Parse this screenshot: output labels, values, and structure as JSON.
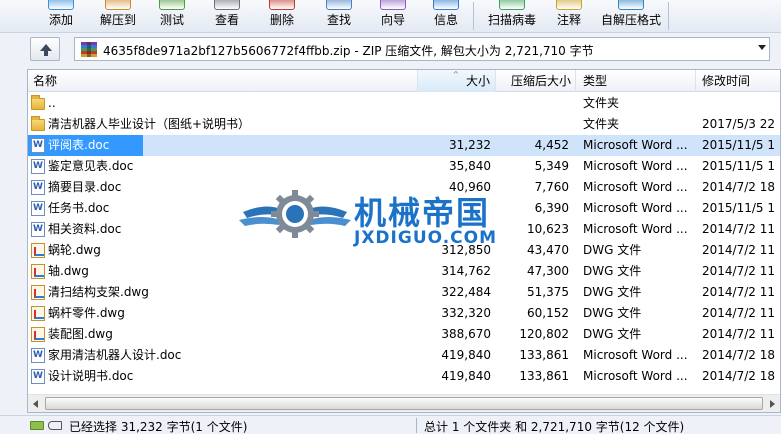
{
  "toolbar": {
    "buttons": [
      {
        "label": "添加",
        "icon": "add-icon",
        "color": "#3b8fd6"
      },
      {
        "label": "解压到",
        "icon": "extract-to-icon",
        "color": "#d08a2a"
      },
      {
        "label": "测试",
        "icon": "test-icon",
        "color": "#4b9d3a"
      },
      {
        "label": "查看",
        "icon": "view-icon",
        "color": "#6a6f7a"
      },
      {
        "label": "删除",
        "icon": "delete-icon",
        "color": "#c0392b"
      },
      {
        "label": "查找",
        "icon": "find-icon",
        "color": "#4a7fc1"
      },
      {
        "label": "向导",
        "icon": "wizard-icon",
        "color": "#8a5cc2"
      },
      {
        "label": "信息",
        "icon": "info-icon",
        "color": "#2f7fd0"
      },
      {
        "label": "扫描病毒",
        "icon": "virus-scan-icon",
        "color": "#3aa05a"
      },
      {
        "label": "注释",
        "icon": "comment-icon",
        "color": "#c9a227"
      },
      {
        "label": "自解压格式",
        "icon": "sfx-icon",
        "color": "#2e86c1"
      }
    ]
  },
  "address": {
    "path": "4635f8de971a2bf127b5606772f4ffbb.zip - ZIP 压缩文件, 解包大小为 2,721,710 字节"
  },
  "columns": {
    "name": "名称",
    "size": "大小",
    "packed": "压缩后大小",
    "type": "类型",
    "modified": "修改时间"
  },
  "files": [
    {
      "name": "..",
      "size": "",
      "packed": "",
      "type": "文件夹",
      "modified": "",
      "kind": "folder"
    },
    {
      "name": "清洁机器人毕业设计（图纸+说明书）",
      "size": "",
      "packed": "",
      "type": "文件夹",
      "modified": "2017/5/3 22",
      "kind": "folder"
    },
    {
      "name": "评阅表.doc",
      "size": "31,232",
      "packed": "4,452",
      "type": "Microsoft Word ...",
      "modified": "2015/11/5 1",
      "kind": "doc",
      "selected": true
    },
    {
      "name": "鉴定意见表.doc",
      "size": "35,840",
      "packed": "5,349",
      "type": "Microsoft Word ...",
      "modified": "2015/11/5 1",
      "kind": "doc"
    },
    {
      "name": "摘要目录.doc",
      "size": "40,960",
      "packed": "7,760",
      "type": "Microsoft Word ...",
      "modified": "2014/7/2 18",
      "kind": "doc"
    },
    {
      "name": "任务书.doc",
      "size": "",
      "packed": "6,390",
      "type": "Microsoft Word ...",
      "modified": "2015/11/5 1",
      "kind": "doc"
    },
    {
      "name": "相关资料.doc",
      "size": "",
      "packed": "10,623",
      "type": "Microsoft Word ...",
      "modified": "2014/7/2 11",
      "kind": "doc"
    },
    {
      "name": "蜗轮.dwg",
      "size": "312,850",
      "packed": "43,470",
      "type": "DWG 文件",
      "modified": "2014/7/2 11",
      "kind": "dwg"
    },
    {
      "name": "轴.dwg",
      "size": "314,762",
      "packed": "47,300",
      "type": "DWG 文件",
      "modified": "2014/7/2 11",
      "kind": "dwg"
    },
    {
      "name": "清扫结构支架.dwg",
      "size": "322,484",
      "packed": "51,375",
      "type": "DWG 文件",
      "modified": "2014/7/2 11",
      "kind": "dwg"
    },
    {
      "name": "蜗杆零件.dwg",
      "size": "332,320",
      "packed": "60,152",
      "type": "DWG 文件",
      "modified": "2014/7/2 11",
      "kind": "dwg"
    },
    {
      "name": "装配图.dwg",
      "size": "388,670",
      "packed": "120,802",
      "type": "DWG 文件",
      "modified": "2014/7/2 11",
      "kind": "dwg"
    },
    {
      "name": "家用清洁机器人设计.doc",
      "size": "419,840",
      "packed": "133,861",
      "type": "Microsoft Word ...",
      "modified": "2014/7/2 18",
      "kind": "doc"
    },
    {
      "name": "设计说明书.doc",
      "size": "419,840",
      "packed": "133,861",
      "type": "Microsoft Word ...",
      "modified": "2014/7/2 18",
      "kind": "doc"
    }
  ],
  "status": {
    "left": "已经选择 31,232 字节(1 个文件)",
    "right": "总计 1 个文件夹 和 2,721,710 字节(12 个文件)"
  },
  "watermark": {
    "title": "机械帝国",
    "subtitle": "JXDIGUO.COM",
    "color": "#1a72c9"
  }
}
